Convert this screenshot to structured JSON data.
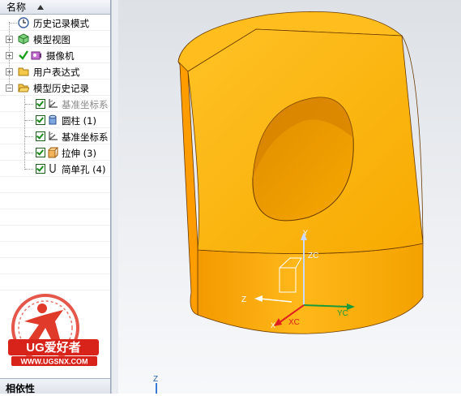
{
  "navigator": {
    "column_header": "名称",
    "rows": [
      {
        "label": "历史记录模式"
      },
      {
        "label": "模型视图"
      },
      {
        "label": "摄像机"
      },
      {
        "label": "用户表达式"
      },
      {
        "label": "模型历史记录"
      },
      {
        "label": "基准坐标系"
      },
      {
        "label": "圆柱 (1)"
      },
      {
        "label": "基准坐标系"
      },
      {
        "label": "拉伸 (3)"
      },
      {
        "label": "简单孔 (4)"
      }
    ],
    "bottom_panel_title": "相依性"
  },
  "watermark": {
    "brand": "UG爱好者",
    "url": "WWW.UGSNX.COM"
  },
  "viewport": {
    "axes": {
      "zc": "ZC",
      "yc": "YC",
      "xc": "XC",
      "z": "Z",
      "y": "Y",
      "x": "X"
    },
    "bottom_axis_label": "Z",
    "model_color": "#f5a300"
  }
}
